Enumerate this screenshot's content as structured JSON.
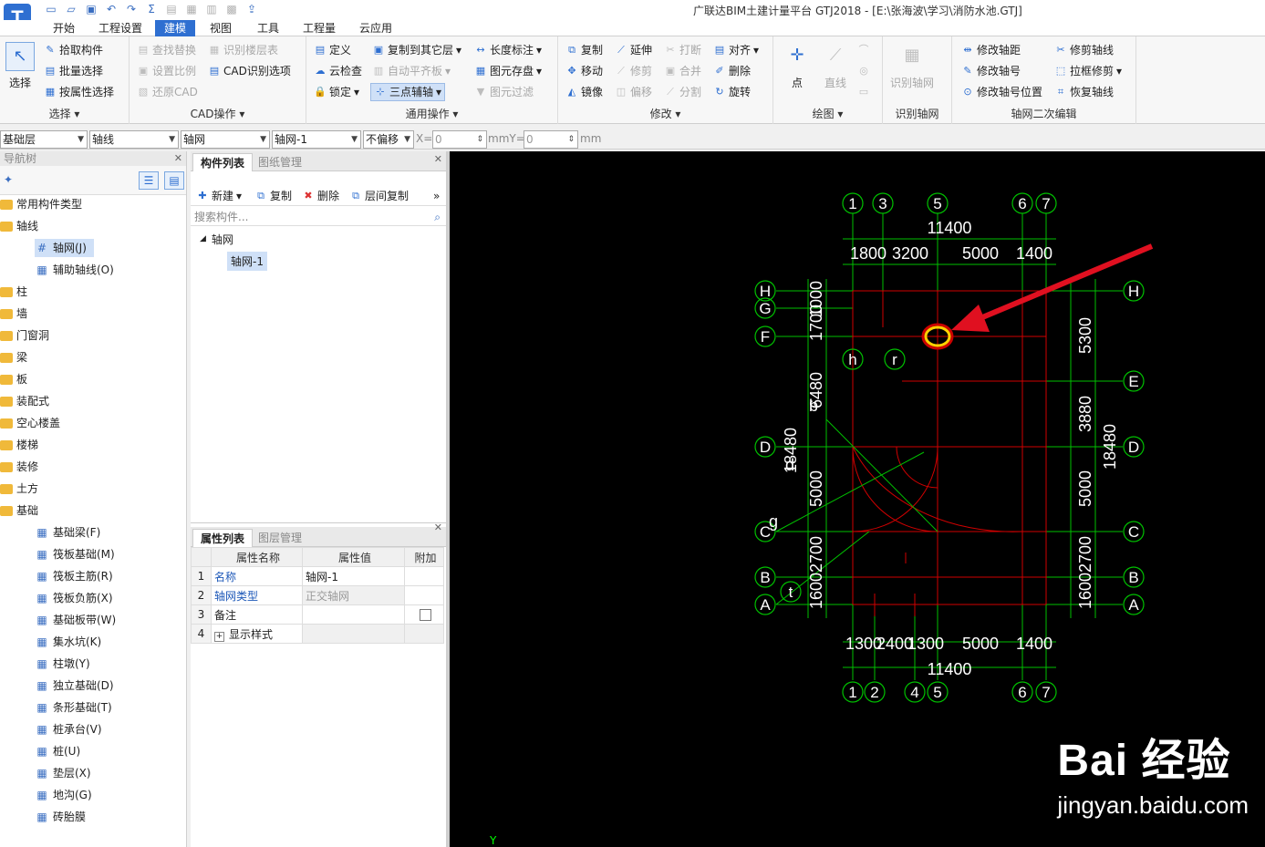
{
  "window": {
    "title": "广联达BIM土建计量平台 GTJ2018 - [E:\\张海波\\学习\\消防水池.GTJ]",
    "logo_text": "T"
  },
  "menu": {
    "tabs": [
      "开始",
      "工程设置",
      "建模",
      "视图",
      "工具",
      "工程量",
      "云应用"
    ],
    "active": "建模"
  },
  "ribbon": {
    "select_group": {
      "label": "选择",
      "big": "选择",
      "items": [
        "拾取构件",
        "批量选择",
        "按属性选择"
      ]
    },
    "cad_group": {
      "label": "CAD操作",
      "items": [
        "查找替换",
        "识别楼层表",
        "设置比例",
        "CAD识别选项",
        "还原CAD"
      ]
    },
    "common_group": {
      "label": "通用操作",
      "items": [
        "定义",
        "复制到其它层",
        "长度标注",
        "云检查",
        "自动平齐板",
        "图元存盘",
        "锁定",
        "三点辅轴",
        "图元过滤"
      ]
    },
    "modify_group": {
      "label": "修改",
      "items": [
        "复制",
        "延伸",
        "打断",
        "对齐",
        "移动",
        "修剪",
        "合并",
        "删除",
        "镜像",
        "偏移",
        "分割",
        "旋转"
      ]
    },
    "draw_group": {
      "label": "绘图",
      "items": [
        "点",
        "直线"
      ]
    },
    "recog_group": {
      "label": "识别轴网",
      "big": "识别轴网"
    },
    "axis_edit_group": {
      "label": "轴网二次编辑",
      "items": [
        "修改轴距",
        "修剪轴线",
        "修改轴号",
        "拉框修剪",
        "修改轴号位置",
        "恢复轴线"
      ]
    }
  },
  "selectors": {
    "floor": "基础层",
    "category": "轴线",
    "type": "轴网",
    "instance": "轴网-1",
    "offset": "不偏移",
    "x_label": "X=",
    "x_value": "0",
    "y_label": "mmY=",
    "y_value": "0",
    "unit": "mm"
  },
  "nav": {
    "title": "导航树",
    "items": [
      "常用构件类型",
      "轴线",
      "轴网(J)",
      "辅助轴线(O)",
      "柱",
      "墙",
      "门窗洞",
      "梁",
      "板",
      "装配式",
      "空心楼盖",
      "楼梯",
      "装修",
      "土方",
      "基础",
      "基础梁(F)",
      "筏板基础(M)",
      "筏板主筋(R)",
      "筏板负筋(X)",
      "基础板带(W)",
      "集水坑(K)",
      "柱墩(Y)",
      "独立基础(D)",
      "条形基础(T)",
      "桩承台(V)",
      "桩(U)",
      "垫层(X)",
      "地沟(G)",
      "砖胎膜"
    ]
  },
  "components": {
    "tabs": [
      "构件列表",
      "图纸管理"
    ],
    "tools": [
      "新建",
      "复制",
      "删除",
      "层间复制"
    ],
    "search_placeholder": "搜索构件...",
    "tree_root": "轴网",
    "tree_child": "轴网-1"
  },
  "properties": {
    "tabs": [
      "属性列表",
      "图层管理"
    ],
    "headers": [
      "属性名称",
      "属性值",
      "附加"
    ],
    "rows": [
      {
        "n": "1",
        "name": "名称",
        "value": "轴网-1"
      },
      {
        "n": "2",
        "name": "轴网类型",
        "value": "正交轴网"
      },
      {
        "n": "3",
        "name": "备注",
        "value": ""
      },
      {
        "n": "4",
        "name": "显示样式",
        "value": ""
      }
    ]
  },
  "canvas": {
    "top_axes": [
      "1",
      "3",
      "5",
      "6",
      "7"
    ],
    "bottom_axes": [
      "1",
      "2",
      "4",
      "5",
      "6",
      "7"
    ],
    "left_axes": [
      "H",
      "G",
      "F",
      "D",
      "C",
      "B",
      "A"
    ],
    "right_axes": [
      "H",
      "E",
      "D",
      "C",
      "B",
      "A"
    ],
    "top_total": "11400",
    "top_dims": [
      "1800",
      "3200",
      "5000",
      "1400"
    ],
    "bottom_total": "11400",
    "bottom_dims": [
      "1300",
      "2400",
      "1300",
      "5000",
      "1400"
    ],
    "left_dims": [
      "1000",
      "1700",
      "6480",
      "18480",
      "5000",
      "1600",
      "2700"
    ],
    "right_dims": [
      "5300",
      "3880",
      "5000",
      "1600",
      "2700",
      "18480"
    ],
    "misc_labels": [
      "h",
      "r",
      "b",
      "d",
      "g",
      "t"
    ],
    "y_label": "Y",
    "colors": {
      "axis": "#00c000",
      "grid": "#d00000",
      "highlight": "#ffd000",
      "arrow": "#e01020"
    }
  },
  "watermark": {
    "big": "Bai 经验",
    "small": "jingyan.baidu.com"
  }
}
